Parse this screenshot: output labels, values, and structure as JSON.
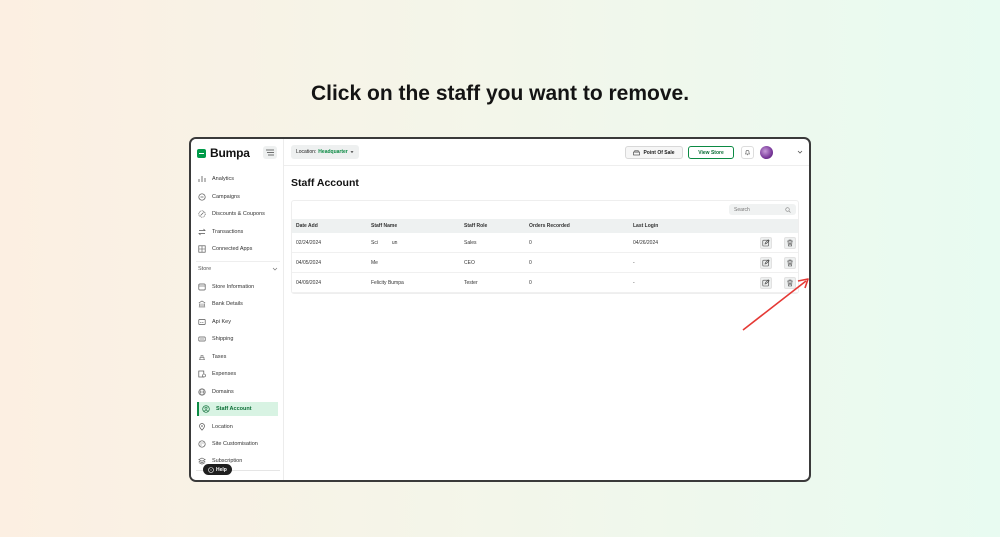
{
  "headline": "Click on the staff you want to remove.",
  "brand": {
    "name": "Bumpa"
  },
  "sidebar": {
    "items": [
      {
        "label": "Analytics",
        "icon": "analytics-icon"
      },
      {
        "label": "Campaigns",
        "icon": "megaphone-icon"
      },
      {
        "label": "Discounts & Coupons",
        "icon": "discount-icon"
      },
      {
        "label": "Transactions",
        "icon": "transfer-icon"
      },
      {
        "label": "Connected Apps",
        "icon": "apps-icon"
      }
    ],
    "section": "Store",
    "store_items": [
      {
        "label": "Store Information",
        "icon": "store-icon"
      },
      {
        "label": "Bank Details",
        "icon": "bank-icon"
      },
      {
        "label": "Api Key",
        "icon": "api-key-icon"
      },
      {
        "label": "Shipping",
        "icon": "shipping-icon"
      },
      {
        "label": "Taxes",
        "icon": "taxes-icon"
      },
      {
        "label": "Expenses",
        "icon": "expenses-icon"
      },
      {
        "label": "Domains",
        "icon": "globe-icon"
      },
      {
        "label": "Staff Account",
        "icon": "staff-icon",
        "active": true
      },
      {
        "label": "Location",
        "icon": "location-icon"
      },
      {
        "label": "Site Customisation",
        "icon": "palette-icon"
      },
      {
        "label": "Subscription",
        "icon": "layers-icon"
      }
    ],
    "help": "Help"
  },
  "topbar": {
    "location_label": "Location:",
    "location_value": "Headquarter",
    "point_of_sale": "Point Of Sale",
    "view_store": "View Store"
  },
  "page": {
    "title": "Staff Account"
  },
  "search": {
    "placeholder": "Search"
  },
  "table": {
    "columns": [
      "Date Add",
      "Staff Name",
      "Staff Role",
      "Orders Recorded",
      "Last Login"
    ],
    "rows": [
      {
        "date": "02/24/2024",
        "name": "Sci          un",
        "role": "Sales",
        "orders": "0",
        "last_login": "04/26/2024"
      },
      {
        "date": "04/05/2024",
        "name": "Me",
        "role": "CEO",
        "orders": "0",
        "last_login": "-"
      },
      {
        "date": "04/09/2024",
        "name": "Felicity Bumpa",
        "role": "Tester",
        "orders": "0",
        "last_login": "-"
      }
    ]
  },
  "colors": {
    "brand_green": "#009a49",
    "active_bg": "#d8f3e3",
    "arrow_red": "#e53935"
  }
}
